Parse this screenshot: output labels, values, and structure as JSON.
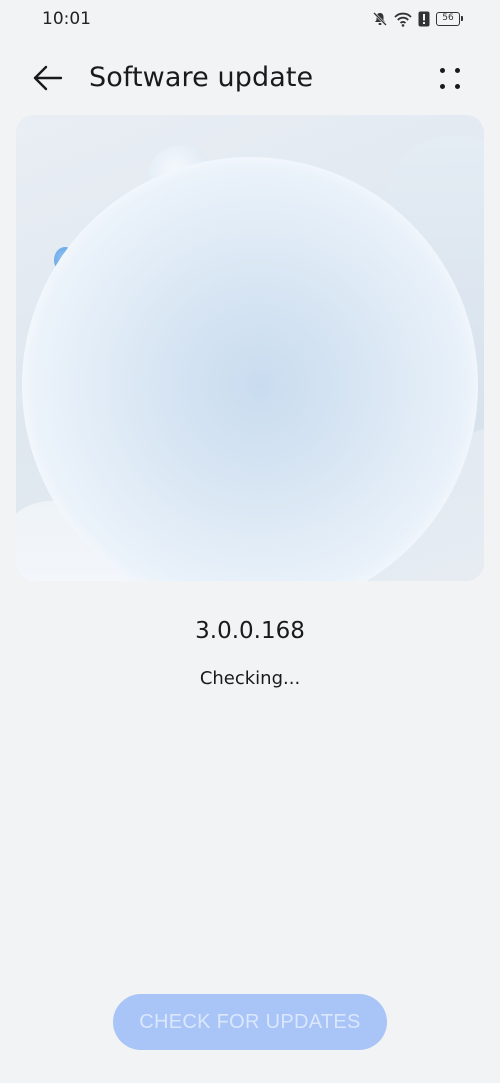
{
  "status_bar": {
    "time": "10:01",
    "battery_level": "56",
    "icons": [
      "mute-bell-icon",
      "wifi-icon",
      "alert-icon",
      "battery-icon"
    ]
  },
  "app_bar": {
    "title": "Software update",
    "back_icon": "back-arrow-icon",
    "more_icon": "more-dots-icon"
  },
  "update": {
    "version": "3.0.0.168",
    "status": "Checking..."
  },
  "actions": {
    "check_label": "CHECK FOR UPDATES"
  },
  "colors": {
    "background": "#f1f3f5",
    "button_bg": "#a9c4f7",
    "button_text": "#dbe7fd"
  }
}
